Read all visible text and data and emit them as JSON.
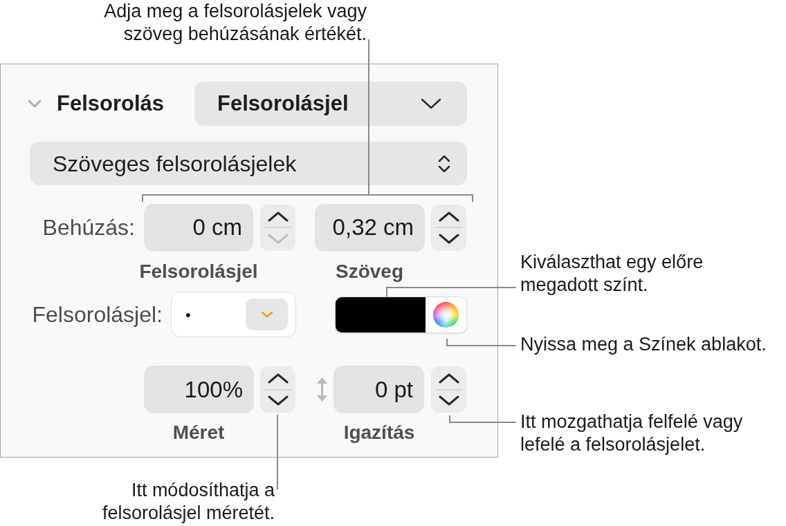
{
  "panel": {
    "header": {
      "title": "Felsorolás",
      "expanded": true,
      "popup": {
        "value": "Felsorolásjel"
      }
    },
    "type_popup": {
      "value": "Szöveges felsorolásjelek"
    },
    "indent": {
      "label": "Behúzás:",
      "fields": [
        {
          "value": "0 cm",
          "caption": "Felsorolásjel",
          "up_disabled": false,
          "down_disabled": true
        },
        {
          "value": "0,32 cm",
          "caption": "Szöveg",
          "up_disabled": false,
          "down_disabled": false
        }
      ]
    },
    "bullet": {
      "label": "Felsorolásjel:",
      "value": "•",
      "color": "#000000"
    },
    "size": {
      "value": "100%",
      "caption": "Méret",
      "up_disabled": false,
      "down_disabled": false
    },
    "alignment": {
      "value": "0 pt",
      "caption": "Igazítás",
      "up_disabled": false,
      "down_disabled": false
    }
  },
  "callouts": [
    {
      "text": "Adja meg a felsorolásjelek vagy\nszöveg behúzásának értékét."
    },
    {
      "text": "Kiválaszthat egy előre\nmegadott színt."
    },
    {
      "text": "Nyissa meg a Színek ablakot."
    },
    {
      "text": "Itt mozgathatja felfelé vagy\nlefelé a felsorolásjelet."
    },
    {
      "text": "Itt módosíthatja a\nfelsorolásjel méretét."
    }
  ]
}
